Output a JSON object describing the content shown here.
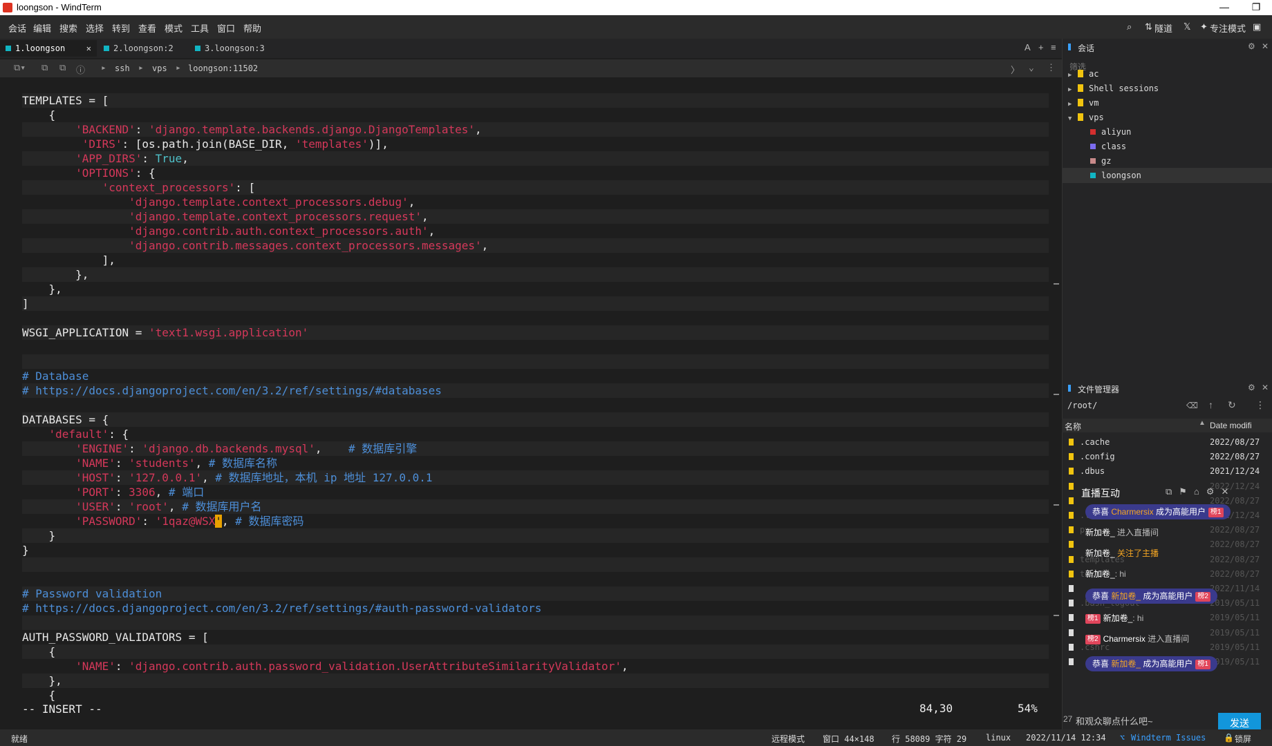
{
  "window": {
    "title": "loongson - WindTerm",
    "minimize": "—",
    "restore": "❐",
    "close": "✕"
  },
  "menu": [
    "会话",
    "编辑",
    "搜索",
    "选择",
    "转到",
    "查看",
    "模式",
    "工具",
    "窗口",
    "帮助"
  ],
  "menu_right": {
    "tunnel": "隧道",
    "focus": "专注模式"
  },
  "tabs": [
    {
      "label": "1.loongson",
      "active": true
    },
    {
      "label": "2.loongson:2",
      "active": false
    },
    {
      "label": "3.loongson:3",
      "active": false
    }
  ],
  "path": [
    "ssh",
    "vps",
    "loongson:11502"
  ],
  "code_lines": [
    [],
    [
      [
        "TEMPLATES = [",
        ""
      ]
    ],
    [
      [
        "    {",
        ""
      ]
    ],
    [
      [
        "        ",
        ""
      ],
      [
        "'BACKEND'",
        "s"
      ],
      [
        ": ",
        ""
      ],
      [
        "'django.template.backends.django.DjangoTemplates'",
        "s"
      ],
      [
        ",",
        ""
      ]
    ],
    [
      [
        "         ",
        ""
      ],
      [
        "'DIRS'",
        "s"
      ],
      [
        ": [os.path.join(BASE_DIR, ",
        ""
      ],
      [
        "'templates'",
        "s"
      ],
      [
        ")],",
        ""
      ]
    ],
    [
      [
        "        ",
        ""
      ],
      [
        "'APP_DIRS'",
        "s"
      ],
      [
        ": ",
        ""
      ],
      [
        "True",
        "kw"
      ],
      [
        ",",
        ""
      ]
    ],
    [
      [
        "        ",
        ""
      ],
      [
        "'OPTIONS'",
        "s"
      ],
      [
        ": {",
        ""
      ]
    ],
    [
      [
        "            ",
        ""
      ],
      [
        "'context_processors'",
        "s"
      ],
      [
        ": [",
        ""
      ]
    ],
    [
      [
        "                ",
        ""
      ],
      [
        "'django.template.context_processors.debug'",
        "s"
      ],
      [
        ",",
        ""
      ]
    ],
    [
      [
        "                ",
        ""
      ],
      [
        "'django.template.context_processors.request'",
        "s"
      ],
      [
        ",",
        ""
      ]
    ],
    [
      [
        "                ",
        ""
      ],
      [
        "'django.contrib.auth.context_processors.auth'",
        "s"
      ],
      [
        ",",
        ""
      ]
    ],
    [
      [
        "                ",
        ""
      ],
      [
        "'django.contrib.messages.context_processors.messages'",
        "s"
      ],
      [
        ",",
        ""
      ]
    ],
    [
      [
        "            ],",
        ""
      ]
    ],
    [
      [
        "        },",
        ""
      ]
    ],
    [
      [
        "    },",
        ""
      ]
    ],
    [
      [
        "]",
        ""
      ]
    ],
    [],
    [
      [
        "WSGI_APPLICATION = ",
        ""
      ],
      [
        "'text1.wsgi.application'",
        "s"
      ]
    ],
    [],
    [],
    [
      [
        "# Database",
        "c"
      ]
    ],
    [
      [
        "# https://docs.djangoproject.com/en/3.2/ref/settings/#databases",
        "c"
      ]
    ],
    [],
    [
      [
        "DATABASES = {",
        ""
      ]
    ],
    [
      [
        "    ",
        ""
      ],
      [
        "'default'",
        "s"
      ],
      [
        ": {",
        ""
      ]
    ],
    [
      [
        "        ",
        ""
      ],
      [
        "'ENGINE'",
        "s"
      ],
      [
        ": ",
        ""
      ],
      [
        "'django.db.backends.mysql'",
        "s"
      ],
      [
        ",    ",
        ""
      ],
      [
        "# 数据库引擎",
        "c"
      ]
    ],
    [
      [
        "        ",
        ""
      ],
      [
        "'NAME'",
        "s"
      ],
      [
        ": ",
        ""
      ],
      [
        "'students'",
        "s"
      ],
      [
        ", ",
        ""
      ],
      [
        "# 数据库名称",
        "c"
      ]
    ],
    [
      [
        "        ",
        ""
      ],
      [
        "'HOST'",
        "s"
      ],
      [
        ": ",
        ""
      ],
      [
        "'127.0.0.1'",
        "s"
      ],
      [
        ", ",
        ""
      ],
      [
        "# 数据库地址，本机 ip 地址 127.0.0.1",
        "c"
      ]
    ],
    [
      [
        "        ",
        ""
      ],
      [
        "'PORT'",
        "s"
      ],
      [
        ": ",
        ""
      ],
      [
        "3306",
        "s"
      ],
      [
        ", ",
        ""
      ],
      [
        "# 端口",
        "c"
      ]
    ],
    [
      [
        "        ",
        ""
      ],
      [
        "'USER'",
        "s"
      ],
      [
        ": ",
        ""
      ],
      [
        "'root'",
        "s"
      ],
      [
        ", ",
        ""
      ],
      [
        "# 数据库用户名",
        "c"
      ]
    ],
    [
      [
        "        ",
        ""
      ],
      [
        "'PASSWORD'",
        "s"
      ],
      [
        ": ",
        ""
      ],
      [
        "'1qaz@WSX",
        "s"
      ],
      [
        "'",
        "cursor"
      ],
      [
        ", ",
        ""
      ],
      [
        "# 数据库密码",
        "c"
      ]
    ],
    [
      [
        "    }",
        ""
      ]
    ],
    [
      [
        "}",
        ""
      ]
    ],
    [],
    [],
    [
      [
        "# Password validation",
        "c"
      ]
    ],
    [
      [
        "# https://docs.djangoproject.com/en/3.2/ref/settings/#auth-password-validators",
        "c"
      ]
    ],
    [],
    [
      [
        "AUTH_PASSWORD_VALIDATORS = [",
        ""
      ]
    ],
    [
      [
        "    {",
        ""
      ]
    ],
    [
      [
        "        ",
        ""
      ],
      [
        "'NAME'",
        "s"
      ],
      [
        ": ",
        ""
      ],
      [
        "'django.contrib.auth.password_validation.UserAttributeSimilarityValidator'",
        "s"
      ],
      [
        ",",
        ""
      ]
    ],
    [
      [
        "    },",
        ""
      ]
    ],
    [
      [
        "    {",
        ""
      ]
    ]
  ],
  "editor_status": {
    "mode": "-- INSERT --",
    "position": "84,30",
    "percent": "54%"
  },
  "sessions": {
    "title": "会话",
    "filter_placeholder": "筛选",
    "items": [
      {
        "label": "ac",
        "level": 0,
        "type": "folder",
        "expanded": false
      },
      {
        "label": "Shell sessions",
        "level": 0,
        "type": "folder",
        "expanded": false
      },
      {
        "label": "vm",
        "level": 0,
        "type": "folder",
        "expanded": false
      },
      {
        "label": "vps",
        "level": 0,
        "type": "folder",
        "expanded": true
      },
      {
        "label": "aliyun",
        "level": 1,
        "type": "session",
        "color": "#d32f2f"
      },
      {
        "label": "class",
        "level": 1,
        "type": "session",
        "color": "#7c6cf0"
      },
      {
        "label": "gz",
        "level": 1,
        "type": "session",
        "color": "#c98a8a"
      },
      {
        "label": "loongson",
        "level": 1,
        "type": "session",
        "color": "#11b5c3",
        "selected": true
      }
    ]
  },
  "file_manager": {
    "title": "文件管理器",
    "path": "/root/",
    "col_name": "名称",
    "col_date": "Date modifi",
    "rows": [
      {
        "name": ".cache",
        "date": "2022/08/27",
        "kind": "folder"
      },
      {
        "name": ".config",
        "date": "2022/08/27",
        "kind": "folder"
      },
      {
        "name": ".dbus",
        "date": "2021/12/24",
        "kind": "folder"
      },
      {
        "name": "",
        "date": "2022/12/24",
        "kind": "folder"
      },
      {
        "name": "",
        "date": "2022/08/27",
        "kind": "folder"
      },
      {
        "name": ".local",
        "date": "2021/12/24",
        "kind": "folder"
      },
      {
        "name": "py",
        "date": "2022/08/27",
        "kind": "folder"
      },
      {
        "name": "",
        "date": "2022/08/27",
        "kind": "folder"
      },
      {
        "name": "templates",
        "date": "2022/08/27",
        "kind": "folder"
      },
      {
        "name": "text1",
        "date": "2022/08/27",
        "kind": "folder"
      },
      {
        "name": "",
        "date": "2022/11/14",
        "kind": "file"
      },
      {
        "name": ".bash_logout",
        "date": "2019/05/11",
        "kind": "file"
      },
      {
        "name": "",
        "date": "2019/05/11",
        "kind": "file"
      },
      {
        "name": "",
        "date": "2019/05/11",
        "kind": "file"
      },
      {
        "name": ".cshrc",
        "date": "2019/05/11",
        "kind": "file"
      },
      {
        "name": "",
        "date": "2019/05/11",
        "kind": "file"
      }
    ]
  },
  "live": {
    "title": "直播互动",
    "messages": [
      {
        "type": "bubble",
        "pre": "恭喜 ",
        "name": "Charmersix",
        "post": " 成为高能用户",
        "badge": "榜1"
      },
      {
        "type": "text",
        "name": "新加卷_",
        "text": " 进入直播间"
      },
      {
        "type": "text",
        "name": "新加卷_",
        "text": " 关注了主播",
        "orange": true
      },
      {
        "type": "text",
        "name": "新加卷_",
        "text": ": hi"
      },
      {
        "type": "bubble",
        "pre": "恭喜 ",
        "name": "新加卷_",
        "post": " 成为高能用户",
        "badge": "榜2"
      },
      {
        "type": "badge-text",
        "badge": "榜1",
        "name": "新加卷_",
        "text": ": hi"
      },
      {
        "type": "badge-text",
        "badge": "榜2",
        "name": "Charmersix",
        "text": " 进入直播间"
      },
      {
        "type": "bubble",
        "pre": "恭喜 ",
        "name": "新加卷_",
        "post": " 成为高能用户",
        "badge": "榜1"
      }
    ],
    "input_placeholder": "和观众聊点什么吧~",
    "send": "发送",
    "counter": "27"
  },
  "statusbar": {
    "ready": "就绪",
    "remote": "远程模式",
    "window": "窗口 44×148",
    "line_char": "行 58089 字符 29",
    "os": "linux",
    "datetime": "2022/11/14 12:34",
    "issues": "Windterm Issues",
    "lock": "锁屏"
  }
}
